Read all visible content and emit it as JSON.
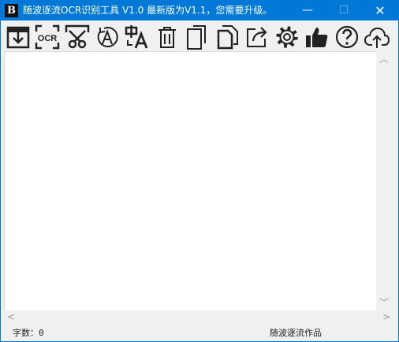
{
  "window": {
    "title": "随波逐流OCR识别工具 V1.0    最新版为V1.1，您需要升级。",
    "app_icon_letter": "B",
    "minimize": "—",
    "maximize": "☐",
    "close": "✕"
  },
  "toolbar": {
    "ocr_label": "OCR",
    "ocr_color": "#222222"
  },
  "editor": {
    "content": ""
  },
  "status": {
    "count_label": "字数：",
    "count_value": "0",
    "author": "随波逐流作品"
  },
  "scroll": {
    "up": "︿",
    "down": "﹀",
    "left": "<",
    "right": ">"
  }
}
